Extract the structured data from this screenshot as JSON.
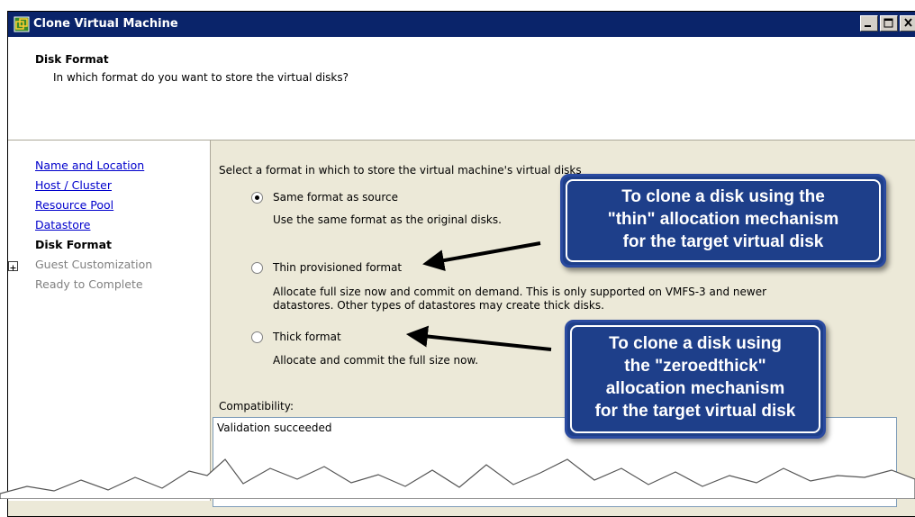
{
  "window": {
    "title": "Clone Virtual Machine",
    "controls": [
      "minimize",
      "maximize",
      "close"
    ]
  },
  "header": {
    "title": "Disk Format",
    "subtitle": "In which format do you want to store the virtual disks?"
  },
  "nav": {
    "items": [
      {
        "label": "Name and Location",
        "state": "link"
      },
      {
        "label": "Host / Cluster",
        "state": "link"
      },
      {
        "label": "Resource Pool",
        "state": "link"
      },
      {
        "label": "Datastore",
        "state": "link"
      },
      {
        "label": "Disk Format",
        "state": "current"
      },
      {
        "label": "Guest Customization",
        "state": "disabled",
        "expandable": true
      },
      {
        "label": "Ready to Complete",
        "state": "disabled"
      }
    ]
  },
  "main": {
    "instruction": "Select a format in which to store the virtual machine's virtual disks",
    "options": [
      {
        "label": "Same format as source",
        "selected": true,
        "description": "Use the same format as the original disks."
      },
      {
        "label": "Thin provisioned format",
        "selected": false,
        "description_line1": "Allocate full size now and commit on demand. This is only supported on VMFS-3 and newer",
        "description_line2": "datastores. Other types of datastores may create thick disks."
      },
      {
        "label": "Thick format",
        "selected": false,
        "description": "Allocate and commit the full size now."
      }
    ],
    "compatibility_label": "Compatibility:",
    "compatibility_value": "Validation succeeded"
  },
  "callouts": {
    "thin": "To clone a disk using the\n\"thin\" allocation mechanism\nfor the target virtual disk",
    "thick": "To clone a disk using\nthe \"zeroedthick\"\nallocation mechanism\nfor the target virtual disk"
  },
  "colors": {
    "titlebar": "#0a246a",
    "callout_bg": "#1e3f8a",
    "link": "#0000cc"
  }
}
